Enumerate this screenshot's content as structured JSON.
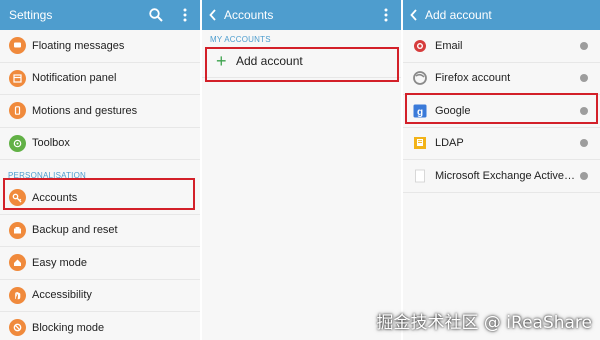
{
  "settings_panel": {
    "title": "Settings",
    "items_top": [
      {
        "label": "Floating messages",
        "icon": "floating-messages-icon"
      },
      {
        "label": "Notification panel",
        "icon": "notification-panel-icon"
      },
      {
        "label": "Motions and gestures",
        "icon": "motions-gestures-icon"
      },
      {
        "label": "Toolbox",
        "icon": "toolbox-icon"
      }
    ],
    "section_label": "PERSONALISATION",
    "items_bottom": [
      {
        "label": "Accounts",
        "icon": "key-icon"
      },
      {
        "label": "Backup and reset",
        "icon": "backup-icon"
      },
      {
        "label": "Easy mode",
        "icon": "easy-mode-icon"
      },
      {
        "label": "Accessibility",
        "icon": "accessibility-icon"
      },
      {
        "label": "Blocking mode",
        "icon": "blocking-mode-icon"
      }
    ]
  },
  "accounts_panel": {
    "title": "Accounts",
    "section_label": "MY ACCOUNTS",
    "add_label": "Add account"
  },
  "add_account_panel": {
    "title": "Add account",
    "items": [
      {
        "label": "Email",
        "icon": "email-icon"
      },
      {
        "label": "Firefox account",
        "icon": "firefox-icon"
      },
      {
        "label": "Google",
        "icon": "google-icon"
      },
      {
        "label": "LDAP",
        "icon": "ldap-icon"
      },
      {
        "label": "Microsoft Exchange ActiveSync",
        "icon": "exchange-icon"
      }
    ]
  },
  "watermark": "掘金技术社区 @ iReaShare",
  "colors": {
    "titlebar": "#4e9dce",
    "accent_orange": "#f08a3c",
    "toolbox_green": "#62b146",
    "highlight_red": "#d32029"
  }
}
